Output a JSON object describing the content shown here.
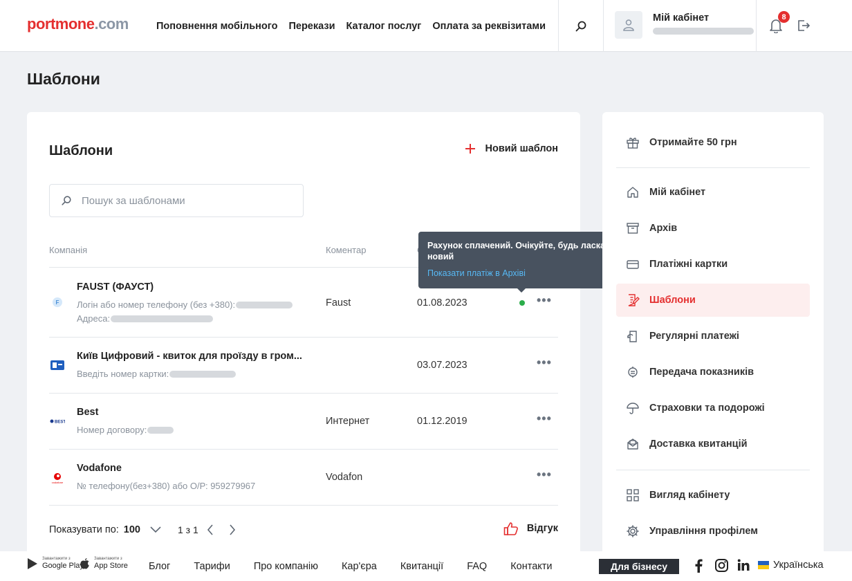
{
  "header": {
    "logo_left": "portmone",
    "logo_right": ".com",
    "nav": [
      "Поповнення мобільного",
      "Перекази",
      "Каталог послуг",
      "Оплата за реквізитами"
    ],
    "cabinet_title": "Мій кабінет",
    "notifications_count": "8"
  },
  "page": {
    "title": "Шаблони"
  },
  "main": {
    "title": "Шаблони",
    "new_template": "Новий шаблон",
    "search_placeholder": "Пошук за шаблонами",
    "columns": {
      "company": "Компанія",
      "comment": "Коментар"
    },
    "rows": [
      {
        "name": "FAUST (ФАУСТ)",
        "meta1": "Логін або номер телефону (без +380):",
        "meta2": "Адреса:",
        "comment": "Faust",
        "date": "01.08.2023"
      },
      {
        "name": "Київ Цифровий - квиток для проїзду в гром...",
        "meta1": "Введіть номер картки:",
        "comment": "",
        "date": "03.07.2023"
      },
      {
        "name": "Best",
        "meta1": "Номер договору:",
        "comment": "Интернет",
        "date": "01.12.2019"
      },
      {
        "name": "Vodafone",
        "meta1": "№ телефону(без+380) або О/Р: 959279967",
        "comment": "Vodafon",
        "date": ""
      }
    ],
    "pagination": {
      "label": "Показувати по:",
      "per_page": "100",
      "page_info": "1 з 1"
    },
    "feedback": "Відгук"
  },
  "tooltip": {
    "text": "Рахунок сплачений. Очікуйте, будь ласка, новий",
    "link": "Показати платіж в Архіві"
  },
  "sidebar": {
    "items": [
      {
        "label": "Отримайте 50 грн",
        "icon": "gift-icon"
      },
      {
        "label": "Мій кабінет",
        "icon": "home-icon"
      },
      {
        "label": "Архів",
        "icon": "archive-icon"
      },
      {
        "label": "Платіжні картки",
        "icon": "card-icon"
      },
      {
        "label": "Шаблони",
        "icon": "template-icon"
      },
      {
        "label": "Регулярні платежі",
        "icon": "recurring-icon"
      },
      {
        "label": "Передача показників",
        "icon": "meter-icon"
      },
      {
        "label": "Страховки та подорожі",
        "icon": "umbrella-icon"
      },
      {
        "label": "Доставка квитанцій",
        "icon": "mail-icon"
      },
      {
        "label": "Вигляд кабінету",
        "icon": "layout-icon"
      },
      {
        "label": "Управління профілем",
        "icon": "settings-icon"
      }
    ]
  },
  "footer": {
    "google_small": "Завантажити з",
    "google_big": "Google Play",
    "apple_small": "Завантажити з",
    "apple_big": "App Store",
    "links": [
      "Блог",
      "Тарифи",
      "Про компанію",
      "Кар'єра",
      "Квитанції",
      "FAQ",
      "Контакти"
    ],
    "business": "Для бізнесу",
    "language": "Українська"
  },
  "colors": {
    "accent": "#e42f2f",
    "tooltip_bg": "#48525f",
    "link": "#57b9f5",
    "status_ok": "#2bad4a"
  }
}
